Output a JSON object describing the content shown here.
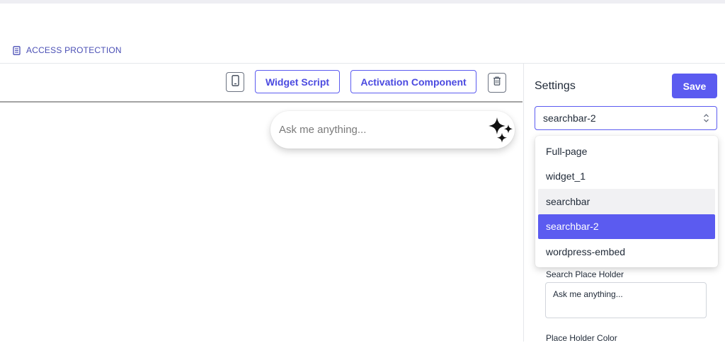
{
  "breadcrumb": {
    "icon": "document-icon",
    "label": "ACCESS PROTECTION"
  },
  "toolbar": {
    "mobile_icon": "mobile-device-icon",
    "widget_script_label": "Widget Script",
    "activation_component_label": "Activation Component",
    "delete_icon": "trash-icon"
  },
  "preview": {
    "search_placeholder": "Ask me anything...",
    "sparkle_icon": "sparkles-icon"
  },
  "settings": {
    "title": "Settings",
    "save_label": "Save",
    "selected_value": "searchbar-2",
    "options": [
      "Full-page",
      "widget_1",
      "searchbar",
      "searchbar-2",
      "wordpress-embed"
    ],
    "hovered_option": "searchbar",
    "search_placeholder_label": "Search Place Holder",
    "search_placeholder_value": "Ask me anything...",
    "placeholder_color_label": "Place Holder Color"
  },
  "colors": {
    "accent": "#5b5bf0",
    "breadcrumb": "#4a4fb5",
    "divider": "#a3a3a3"
  }
}
